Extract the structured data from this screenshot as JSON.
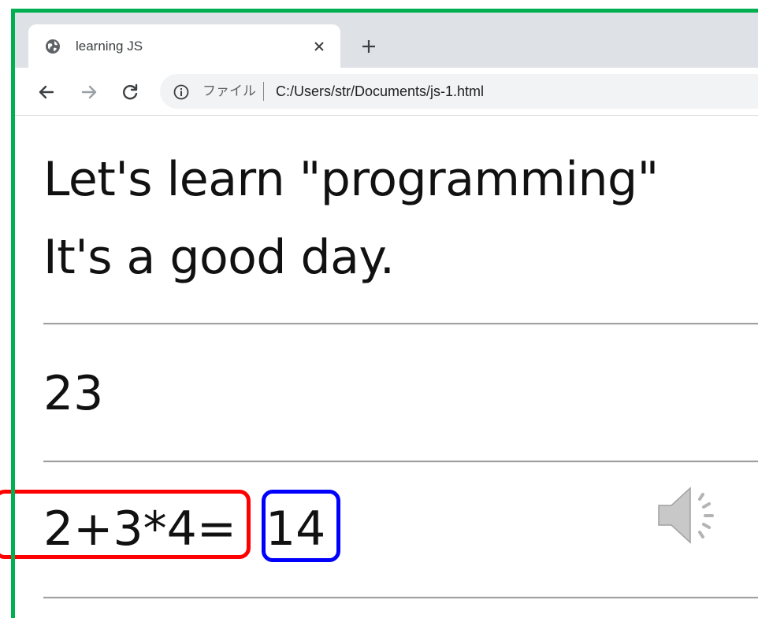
{
  "browser": {
    "tab": {
      "favicon": "globe-icon",
      "title": "learning JS",
      "close_icon": "close-icon"
    },
    "new_tab_icon": "plus-icon",
    "nav": {
      "back_icon": "back-arrow-icon",
      "forward_icon": "forward-arrow-icon",
      "reload_icon": "reload-icon"
    },
    "address": {
      "info_icon": "info-icon",
      "scheme_label": "ファイル",
      "url": "C:/Users/str/Documents/js-1.html"
    }
  },
  "page": {
    "heading_line1": "Let's learn \"programming\"",
    "heading_line2": "It's a good day.",
    "output_number": "23",
    "expression": "2+3*4=",
    "result": "14",
    "speaker_icon": "speaker-icon"
  },
  "colors": {
    "frame": "#00b050",
    "highlight_expression": "#ff0000",
    "highlight_result": "#0000ff",
    "tabstrip": "#dee1e6"
  }
}
